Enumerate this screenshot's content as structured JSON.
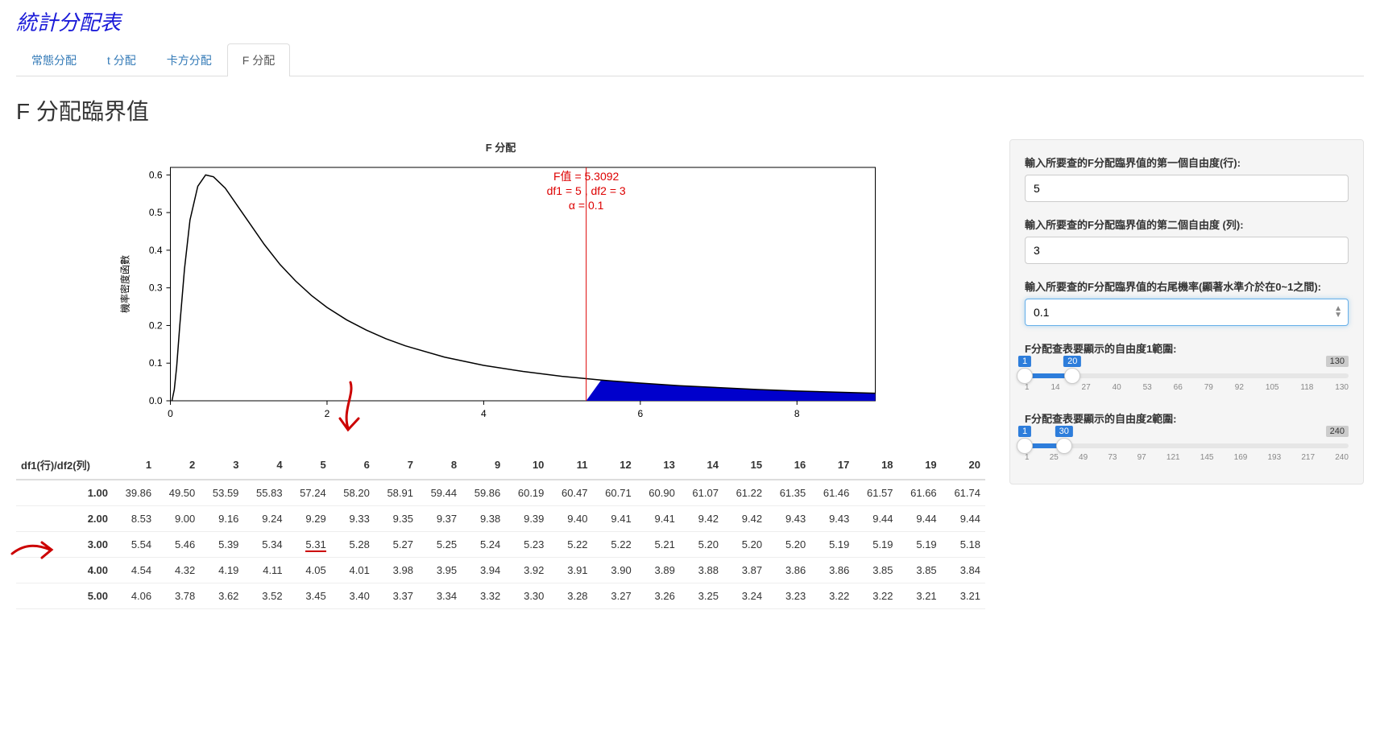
{
  "header": {
    "main_title": "統計分配表",
    "tabs": [
      "常態分配",
      "t 分配",
      "卡方分配",
      "F 分配"
    ],
    "active_tab_index": 3,
    "sub_title": "F 分配臨界值"
  },
  "chart_data": {
    "type": "line",
    "title": "F 分配",
    "xlabel": "",
    "ylabel": "機率密度函數",
    "xlim": [
      0,
      9
    ],
    "ylim": [
      0,
      0.62
    ],
    "x_ticks": [
      0,
      2,
      4,
      6,
      8
    ],
    "y_ticks": [
      0.0,
      0.1,
      0.2,
      0.3,
      0.4,
      0.5,
      0.6
    ],
    "critical_value": 5.3092,
    "df1": 5,
    "df2": 3,
    "alpha": 0.1,
    "annotation_lines": [
      "F值 = 5.3092",
      "df1 =  5 , df2 =  3",
      "α =  0.1"
    ],
    "curve": [
      [
        0.02,
        0.0
      ],
      [
        0.05,
        0.03
      ],
      [
        0.08,
        0.09
      ],
      [
        0.12,
        0.2
      ],
      [
        0.18,
        0.35
      ],
      [
        0.25,
        0.48
      ],
      [
        0.35,
        0.57
      ],
      [
        0.45,
        0.6
      ],
      [
        0.55,
        0.595
      ],
      [
        0.7,
        0.565
      ],
      [
        0.85,
        0.52
      ],
      [
        1.0,
        0.475
      ],
      [
        1.2,
        0.415
      ],
      [
        1.4,
        0.362
      ],
      [
        1.6,
        0.318
      ],
      [
        1.8,
        0.28
      ],
      [
        2.0,
        0.248
      ],
      [
        2.25,
        0.215
      ],
      [
        2.5,
        0.188
      ],
      [
        2.75,
        0.165
      ],
      [
        3.0,
        0.146
      ],
      [
        3.5,
        0.116
      ],
      [
        4.0,
        0.094
      ],
      [
        4.5,
        0.078
      ],
      [
        5.0,
        0.065
      ],
      [
        5.5,
        0.055
      ],
      [
        6.0,
        0.047
      ],
      [
        6.5,
        0.04
      ],
      [
        7.0,
        0.035
      ],
      [
        7.5,
        0.03
      ],
      [
        8.0,
        0.026
      ],
      [
        8.5,
        0.023
      ],
      [
        9.0,
        0.02
      ]
    ]
  },
  "side": {
    "df1_label": "輸入所要查的F分配臨界值的第一個自由度(行):",
    "df1_value": "5",
    "df2_label": "輸入所要查的F分配臨界值的第二個自由度 (列):",
    "df2_value": "3",
    "alpha_label": "輸入所要查的F分配臨界值的右尾機率(顯著水準介於在0~1之間):",
    "alpha_value": "0.1",
    "slider1_label": "F分配查表要顯示的自由度1範圍:",
    "slider1": {
      "min": 1,
      "max": 130,
      "lo": 1,
      "hi": 20,
      "ticks": [
        1,
        14,
        27,
        40,
        53,
        66,
        79,
        92,
        105,
        118,
        130
      ]
    },
    "slider2_label": "F分配查表要顯示的自由度2範圍:",
    "slider2": {
      "min": 1,
      "max": 240,
      "lo": 1,
      "hi": 30,
      "ticks": [
        1,
        25,
        49,
        73,
        97,
        121,
        145,
        169,
        193,
        217,
        240
      ]
    }
  },
  "table": {
    "corner": "df1(行)/df2(列)",
    "df1_headers": [
      1,
      2,
      3,
      4,
      5,
      6,
      7,
      8,
      9,
      10,
      11,
      12,
      13,
      14,
      15,
      16,
      17,
      18,
      19,
      20
    ],
    "rows": [
      {
        "df2": "1.00",
        "vals": [
          39.86,
          49.5,
          53.59,
          55.83,
          57.24,
          58.2,
          58.91,
          59.44,
          59.86,
          60.19,
          60.47,
          60.71,
          60.9,
          61.07,
          61.22,
          61.35,
          61.46,
          61.57,
          61.66,
          61.74
        ]
      },
      {
        "df2": "2.00",
        "vals": [
          8.53,
          9.0,
          9.16,
          9.24,
          9.29,
          9.33,
          9.35,
          9.37,
          9.38,
          9.39,
          9.4,
          9.41,
          9.41,
          9.42,
          9.42,
          9.43,
          9.43,
          9.44,
          9.44,
          9.44
        ]
      },
      {
        "df2": "3.00",
        "vals": [
          5.54,
          5.46,
          5.39,
          5.34,
          5.31,
          5.28,
          5.27,
          5.25,
          5.24,
          5.23,
          5.22,
          5.22,
          5.21,
          5.2,
          5.2,
          5.2,
          5.19,
          5.19,
          5.19,
          5.18
        ]
      },
      {
        "df2": "4.00",
        "vals": [
          4.54,
          4.32,
          4.19,
          4.11,
          4.05,
          4.01,
          3.98,
          3.95,
          3.94,
          3.92,
          3.91,
          3.9,
          3.89,
          3.88,
          3.87,
          3.86,
          3.86,
          3.85,
          3.85,
          3.84
        ]
      },
      {
        "df2": "5.00",
        "vals": [
          4.06,
          3.78,
          3.62,
          3.52,
          3.45,
          3.4,
          3.37,
          3.34,
          3.32,
          3.3,
          3.28,
          3.27,
          3.26,
          3.25,
          3.24,
          3.23,
          3.22,
          3.22,
          3.21,
          3.21
        ]
      }
    ],
    "highlight": {
      "row_index": 2,
      "col_index": 4
    }
  }
}
